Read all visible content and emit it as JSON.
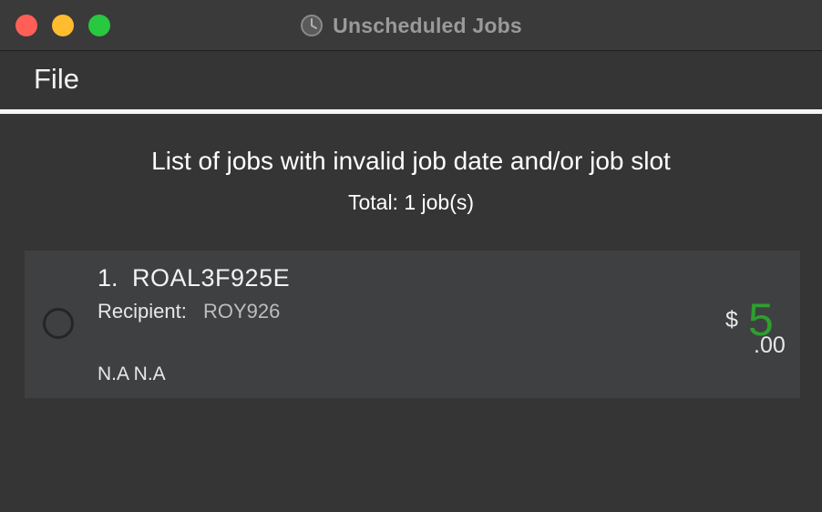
{
  "window": {
    "title": "Unscheduled Jobs",
    "title_icon": "clock-icon",
    "controls": [
      "close",
      "minimize",
      "maximize"
    ],
    "colors": {
      "close": "#ff5f57",
      "minimize": "#febc2e",
      "maximize": "#28c840"
    }
  },
  "menubar": {
    "file_label": "File"
  },
  "main": {
    "heading": "List of jobs with invalid job date and/or job slot",
    "total": "Total: 1 job(s)"
  },
  "jobs": [
    {
      "index": "1.",
      "id": "ROAL3F925E",
      "recipient_label": "Recipient:",
      "recipient": "ROY926",
      "datetime": "N.A N.A",
      "currency": "$",
      "price_main": "5",
      "price_cents": ".00",
      "price_color": "#2e9e2e"
    }
  ]
}
